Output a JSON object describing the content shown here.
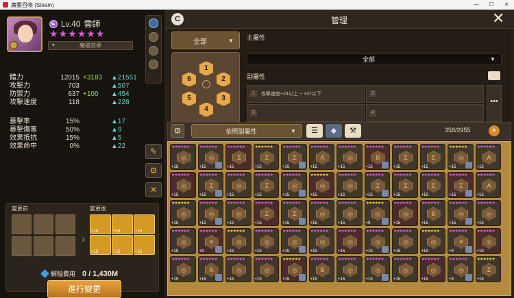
{
  "window": {
    "title": "魔靈召喚 (Steam)",
    "controls": [
      "—",
      "☐",
      "✕"
    ]
  },
  "monster": {
    "element": "☯",
    "level": "Lv.40",
    "name": "雲師",
    "stars": 6,
    "effect_label": "魔磁效果"
  },
  "stats": [
    {
      "name": "體力",
      "base": "12015",
      "bonus": "+3183",
      "pct": "▲21551"
    },
    {
      "name": "攻擊力",
      "base": "703",
      "bonus": "",
      "pct": "▲507"
    },
    {
      "name": "防禦力",
      "base": "637",
      "bonus": "+100",
      "pct": "▲454"
    },
    {
      "name": "攻擊速度",
      "base": "118",
      "bonus": "",
      "pct": "▲228"
    },
    {
      "name": "暴擊率",
      "base": "15%",
      "bonus": "",
      "pct": "▲17"
    },
    {
      "name": "暴擊傷害",
      "base": "50%",
      "bonus": "",
      "pct": "▲9"
    },
    {
      "name": "效果抵抗",
      "base": "15%",
      "bonus": "",
      "pct": "▲5"
    },
    {
      "name": "效果命中",
      "base": "0%",
      "bonus": "",
      "pct": "▲22"
    }
  ],
  "change": {
    "before_label": "變更前",
    "after_label": "變更後",
    "cost_label": "解除費用",
    "cost_value": "0 / 1,430M",
    "apply_button": "進行變更"
  },
  "manage": {
    "badge": "C",
    "title": "管理",
    "close": "✕",
    "filter_all": "全部",
    "slots": [
      "1",
      "2",
      "3",
      "4",
      "5",
      "6"
    ],
    "main_attr_label": "主屬性",
    "main_attr_value": "全部",
    "sub_attr_label": "副屬性",
    "sub_slots": [
      {
        "num": "1",
        "text": "攻擊速度+24以上 ~ +37以下"
      },
      {
        "num": "2",
        "text": ""
      },
      {
        "num": "3",
        "text": ""
      },
      {
        "num": "4",
        "text": ""
      }
    ],
    "more": "•••",
    "sort_label": "依照副屬性",
    "count": "358/2955",
    "plus": "+"
  },
  "rune_levels": [
    "+15",
    "+15",
    "+15",
    "+15",
    "+15",
    "+15",
    "+15",
    "+15",
    "+15",
    "+15",
    "+15",
    "+15",
    "+15",
    "+15",
    "+15",
    "+15",
    "+15",
    "+15",
    "+15",
    "+15",
    "+15",
    "+15",
    "+15",
    "+15",
    "+15",
    "+12",
    "+12",
    "+15",
    "+15",
    "+15",
    "+15",
    "+9",
    "+15",
    "+15",
    "+15",
    "+15",
    "+15",
    "+9",
    "+15",
    "+15",
    "+15",
    "+15",
    "+15",
    "+15",
    "+15",
    "+15",
    "+9",
    "+15",
    "+15",
    "+15",
    "+15",
    "+15",
    "+15",
    "+15",
    "+15",
    "+15",
    "+15",
    "+15",
    "+9",
    "+15"
  ],
  "rune_glyphs": [
    "◎",
    "◎",
    "Σ",
    "Σ",
    "Σ",
    "A",
    "◎",
    "B",
    "Σ",
    "Σ",
    "◎",
    "A",
    "◎",
    "Σ",
    "◎",
    "Σ",
    "◎",
    "◎",
    "◎",
    "Σ",
    "Σ",
    "Σ",
    "Σ",
    "A",
    "◎",
    "◎",
    "◎",
    "Σ",
    "Σ",
    "◎",
    "◎",
    "◎",
    "◎",
    "B",
    "◎",
    "◎",
    "◎",
    "✕",
    "◎",
    "◎",
    "◎",
    "◎",
    "◎",
    "◎",
    "◎",
    "◎",
    "✕",
    "◎",
    "◎",
    "A",
    "◎",
    "◎",
    "◎",
    "B",
    "◎",
    "◎",
    "◎",
    "◎",
    "◎",
    "Σ"
  ]
}
